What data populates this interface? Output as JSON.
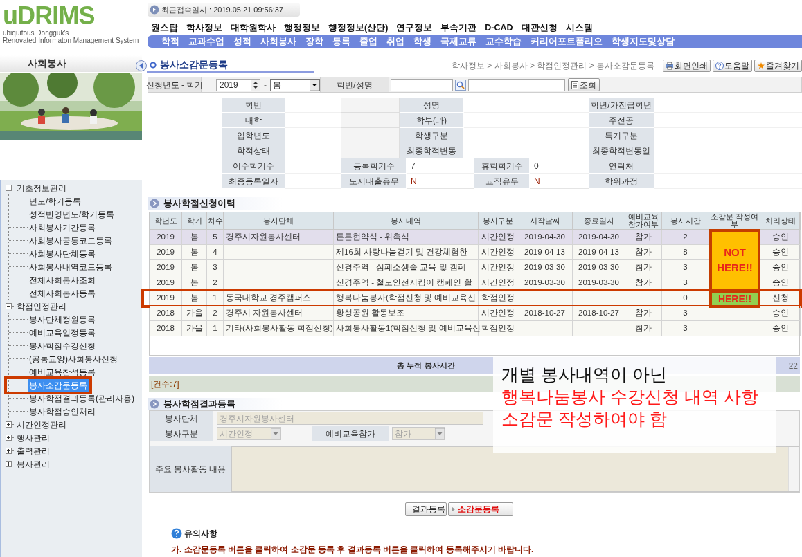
{
  "header": {
    "logo": "uDRIMS",
    "logo_subtitle": [
      "ubiquitous Dongguk's",
      "Renovated Informaton Management System"
    ],
    "last_login": "최근접속일시 : 2019.05.21 09:56:37"
  },
  "menu": {
    "primary": [
      "원스탑",
      "학사정보",
      "대학원학사",
      "행정정보",
      "행정정보(산단)",
      "연구정보",
      "부속기관",
      "D-CAD",
      "대관신청",
      "시스템"
    ],
    "secondary": [
      "학적",
      "교과수업",
      "성적",
      "사회봉사",
      "장학",
      "등록",
      "졸업",
      "취업",
      "학생",
      "국제교류",
      "교수학습",
      "커리어포트폴리오",
      "학생지도및상담"
    ]
  },
  "sidebar": {
    "title": "사회봉사",
    "tree": [
      {
        "label": "기초정보관리",
        "expanded": true,
        "selected": false,
        "highlighted": false,
        "children": [
          {
            "label": "년도/학기등록",
            "selected": false,
            "highlighted": false
          },
          {
            "label": "성적반영년도/학기등록",
            "selected": false,
            "highlighted": false
          },
          {
            "label": "사회봉사기간등록",
            "selected": false,
            "highlighted": false
          },
          {
            "label": "사회봉사공통코드등록",
            "selected": false,
            "highlighted": false
          },
          {
            "label": "사회봉사단체등록",
            "selected": false,
            "highlighted": false
          },
          {
            "label": "사회봉사내역코드등록",
            "selected": false,
            "highlighted": false
          },
          {
            "label": "전체사회봉사조회",
            "selected": false,
            "highlighted": false
          },
          {
            "label": "전체사회봉사등록",
            "selected": false,
            "highlighted": false
          }
        ]
      },
      {
        "label": "학점인정관리",
        "expanded": true,
        "selected": false,
        "highlighted": false,
        "children": [
          {
            "label": "봉사단체정원등록",
            "selected": false,
            "highlighted": false
          },
          {
            "label": "예비교육일정등록",
            "selected": false,
            "highlighted": false
          },
          {
            "label": "봉사학점수강신청",
            "selected": false,
            "highlighted": false
          },
          {
            "label": "(공통교양)사회봉사신청",
            "selected": false,
            "highlighted": false
          },
          {
            "label": "예비교육참석등록",
            "selected": false,
            "highlighted": false
          },
          {
            "label": "봉사소감문등록",
            "selected": true,
            "highlighted": true
          },
          {
            "label": "봉사학점결과등록(관리자용)",
            "selected": false,
            "highlighted": false
          },
          {
            "label": "봉사학점승인처리",
            "selected": false,
            "highlighted": false
          }
        ]
      },
      {
        "label": "시간인정관리",
        "expanded": false,
        "selected": false,
        "highlighted": false
      },
      {
        "label": "행사관리",
        "expanded": false,
        "selected": false,
        "highlighted": false
      },
      {
        "label": "출력관리",
        "expanded": false,
        "selected": false,
        "highlighted": false
      },
      {
        "label": "봉사관리",
        "expanded": false,
        "selected": false,
        "highlighted": false
      }
    ]
  },
  "page": {
    "title": "봉사소감문등록",
    "breadcrumb": "학사정보 > 사회봉사 > 학점인정관리 > 봉사소감문등록",
    "buttons": [
      {
        "kind": "print",
        "label": "화면인쇄"
      },
      {
        "kind": "help",
        "label": "도움말"
      },
      {
        "kind": "favorite",
        "label": "즐겨찾기"
      }
    ]
  },
  "search": {
    "year_label": "신청년도 - 학기",
    "year": "2019",
    "separator": "-",
    "term": "봄",
    "id_label": "학번/성명",
    "search_button": "조회"
  },
  "student_info": {
    "rows": [
      {
        "cells": [
          {
            "kind": "label",
            "text": "학번"
          },
          {
            "kind": "value"
          },
          {
            "kind": "blank"
          },
          {
            "kind": "label",
            "text": "성명"
          },
          {
            "kind": "value"
          },
          {
            "kind": "label",
            "text": "학년/가진급학년"
          },
          {
            "kind": "value"
          }
        ]
      },
      {
        "cells": [
          {
            "kind": "label",
            "text": "대학"
          },
          {
            "kind": "value"
          },
          {
            "kind": "blank"
          },
          {
            "kind": "label",
            "text": "학부(과)"
          },
          {
            "kind": "value"
          },
          {
            "kind": "label",
            "text": "주전공"
          },
          {
            "kind": "value"
          }
        ]
      },
      {
        "cells": [
          {
            "kind": "label",
            "text": "입학년도"
          },
          {
            "kind": "value"
          },
          {
            "kind": "blank"
          },
          {
            "kind": "label",
            "text": "학생구분"
          },
          {
            "kind": "value"
          },
          {
            "kind": "label",
            "text": "특기구분"
          },
          {
            "kind": "value"
          }
        ]
      },
      {
        "cells": [
          {
            "kind": "label",
            "text": "학적상태"
          },
          {
            "kind": "value"
          },
          {
            "kind": "blank"
          },
          {
            "kind": "label",
            "text": "최종학적변동"
          },
          {
            "kind": "value"
          },
          {
            "kind": "label",
            "text": "최종학적변동일"
          },
          {
            "kind": "value"
          }
        ]
      },
      {
        "cells": [
          {
            "kind": "label",
            "text": "이수학기수"
          },
          {
            "kind": "value"
          },
          {
            "kind": "label",
            "text": "등록학기수"
          },
          {
            "kind": "value",
            "text": "7"
          },
          {
            "kind": "label",
            "text": "휴학학기수"
          },
          {
            "kind": "value",
            "text": "0"
          },
          {
            "kind": "label",
            "text": "연락처"
          },
          {
            "kind": "value"
          }
        ]
      },
      {
        "cells": [
          {
            "kind": "label",
            "text": "최종등록일자"
          },
          {
            "kind": "value"
          },
          {
            "kind": "label",
            "text": "도서대출유무"
          },
          {
            "kind": "flag",
            "text": "N"
          },
          {
            "kind": "label",
            "text": "교직유무"
          },
          {
            "kind": "flag",
            "text": "N"
          },
          {
            "kind": "label",
            "text": "학위과정"
          },
          {
            "kind": "value"
          }
        ]
      }
    ]
  },
  "history": {
    "title": "봉사학점신청이력",
    "columns": [
      "학년도",
      "학기",
      "차수",
      "봉사단체",
      "봉사내역",
      "봉사구분",
      "시작날짜",
      "종료일자",
      "예비교육 참가여부",
      "봉사시간",
      "소감문 작성여부",
      "처리상태"
    ],
    "rows": [
      {
        "year": "2019",
        "term": "봄",
        "seq": "5",
        "org": "경주시자원봉사센터",
        "detail": "든든협약식 - 위촉식",
        "type": "시간인정",
        "start": "2019-04-30",
        "end": "2019-04-30",
        "pre_edu": "참가",
        "hours": "2",
        "status": "승인",
        "selected": true,
        "highlighted": false
      },
      {
        "year": "2019",
        "term": "봄",
        "seq": "4",
        "detail": "제16회 사랑나눔걷기 및 건강체험한",
        "type": "시간인정",
        "start": "2019-04-13",
        "end": "2019-04-13",
        "pre_edu": "참가",
        "hours": "8",
        "status": "승인",
        "selected": false,
        "highlighted": false
      },
      {
        "year": "2019",
        "term": "봄",
        "seq": "3",
        "detail": "신경주역 - 심폐소생술 교육 및 캠페",
        "type": "시간인정",
        "start": "2019-03-30",
        "end": "2019-03-30",
        "pre_edu": "참가",
        "hours": "3",
        "status": "승인",
        "selected": false,
        "highlighted": false
      },
      {
        "year": "2019",
        "term": "봄",
        "seq": "2",
        "detail": "신경주역 - 철도안전지킴이 캠페인 활",
        "type": "시간인정",
        "start": "2019-03-30",
        "end": "2019-03-30",
        "pre_edu": "참가",
        "hours": "3",
        "status": "승인",
        "selected": false,
        "highlighted": false
      },
      {
        "year": "2019",
        "term": "봄",
        "seq": "1",
        "org": "동국대학교 경주캠퍼스",
        "detail": "행복나눔봉사(학점신청 및 예비교육신",
        "type": "학점인정",
        "hours": "0",
        "status": "신청",
        "selected": false,
        "highlighted": true
      },
      {
        "year": "2018",
        "term": "가을",
        "seq": "2",
        "org": "경주시 자원봉사센터",
        "detail": "황성공원 활동보조",
        "type": "시간인정",
        "start": "2018-10-27",
        "end": "2018-10-27",
        "pre_edu": "참가",
        "hours": "3",
        "status": "승인",
        "selected": false,
        "highlighted": false
      },
      {
        "year": "2018",
        "term": "가을",
        "seq": "1",
        "org": "기타(사회봉사활동 학점신청)",
        "detail": "사회봉사활동1(학점신청 및 예비교육신",
        "type": "학점인정",
        "pre_edu": "참가",
        "hours": "3",
        "status": "승인",
        "selected": false,
        "highlighted": false
      }
    ],
    "total_label": "총 누적 봉사시간",
    "total_value": "22",
    "count": "[건수:7]"
  },
  "result_form": {
    "title": "봉사학점결과등록",
    "disabled": true,
    "org_label": "봉사단체",
    "org_value": "경주시자원봉사센터",
    "type_label": "봉사구분",
    "type_value": "시간인정",
    "pre_label": "예비교육참가",
    "pre_value": "참가",
    "content_label": "주요 봉사활동 내용",
    "buttons": [
      {
        "kind": "normal",
        "label": "결과등록"
      },
      {
        "kind": "primary",
        "label": "소감문등록"
      }
    ]
  },
  "notice": {
    "title": "유의사항",
    "text": "가. 소감문등록 버튼을 클릭하여 소감문 등록 후 결과등록 버튼을 클릭하여 등록해주시기 바랍니다."
  },
  "annotations": {
    "marks": [
      {
        "kind": "wrong",
        "text": "NOT HERE!!"
      },
      {
        "kind": "right",
        "text": "HERE!!"
      }
    ],
    "callout": [
      {
        "kind": "plain",
        "text": "개별 봉사내역이 아닌"
      },
      {
        "kind": "alert",
        "text": "행복나눔봉사 수강신청 내역 사항"
      },
      {
        "kind": "alert",
        "text": "소감문 작성하여야 함"
      }
    ]
  }
}
